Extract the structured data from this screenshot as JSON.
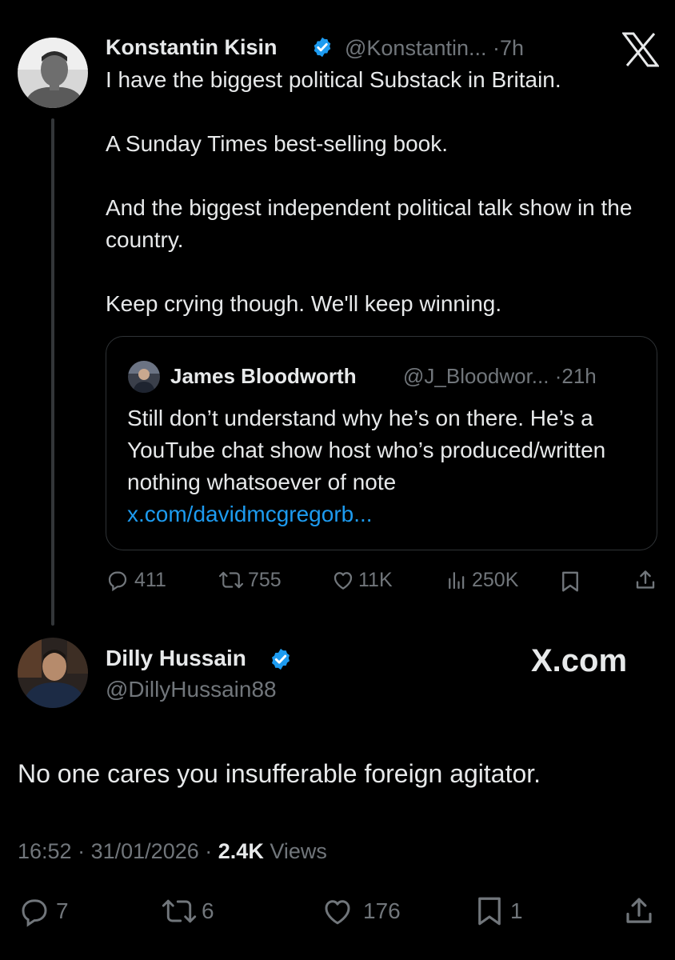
{
  "main_tweet": {
    "author_name": "Konstantin Kisin",
    "handle": "@Konstantin...",
    "separator": "·",
    "time": "7h",
    "text": "I have the biggest political Substack in Britain.\n\nA Sunday Times best-selling book.\n\nAnd the biggest independent political talk show in the country.\n\nKeep crying though. We'll keep winning.",
    "quote": {
      "author_name": "James Bloodworth",
      "handle": "@J_Bloodwor...",
      "separator": "·",
      "time": "21h",
      "text": "Still don’t understand why he’s on there. He’s a YouTube chat show host who’s produced/written nothing whatsoever of note ",
      "link": "x.com/davidmcgregorb..."
    },
    "actions": {
      "replies": "411",
      "reposts": "755",
      "likes": "11K",
      "views": "250K"
    }
  },
  "reply_tweet": {
    "author_name": "Dilly Hussain",
    "handle": "@DillyHussain88",
    "text": "No one cares you insufferable foreign agitator.",
    "time": "16:52",
    "separator1": "·",
    "date": "31/01/2026",
    "separator2": "·",
    "views_count": "2.4K",
    "views_label": "Views",
    "actions": {
      "replies": "7",
      "reposts": "6",
      "likes": "176",
      "bookmarks": "1"
    }
  },
  "branding": {
    "x_logo": "X",
    "x_com": "X.com"
  },
  "icons": [
    "verified-badge-icon",
    "x-logo-icon",
    "reply-icon",
    "repost-icon",
    "like-icon",
    "views-icon",
    "bookmark-icon",
    "share-icon"
  ],
  "colors": {
    "background": "#000000",
    "text": "#e7e9ea",
    "muted": "#71767b",
    "link": "#1d9bf0",
    "verified": "#1d9bf0",
    "border": "#2f3336"
  }
}
